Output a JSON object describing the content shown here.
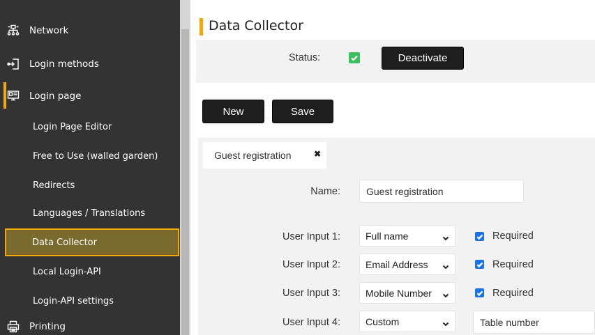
{
  "sidebar": {
    "items": [
      {
        "label": "Network",
        "icon": "network-icon"
      },
      {
        "label": "Login methods",
        "icon": "login-methods-icon"
      },
      {
        "label": "Login page",
        "icon": "login-page-icon"
      },
      {
        "label": "Printing",
        "icon": "printer-icon"
      }
    ],
    "subitems": [
      {
        "label": "Login Page Editor"
      },
      {
        "label": "Free to Use (walled garden)"
      },
      {
        "label": "Redirects"
      },
      {
        "label": "Languages / Translations"
      },
      {
        "label": "Data Collector",
        "active": true
      },
      {
        "label": "Local Login-API"
      },
      {
        "label": "Login-API settings"
      }
    ]
  },
  "page": {
    "title": "Data Collector"
  },
  "status": {
    "label": "Status:",
    "checked": true,
    "deactivate_label": "Deactivate"
  },
  "toolbar": {
    "new_label": "New",
    "save_label": "Save"
  },
  "tabs": [
    {
      "label": "Guest registration",
      "close": "✖"
    }
  ],
  "form": {
    "name_label": "Name:",
    "name_value": "Guest registration",
    "inputs": [
      {
        "label": "User Input 1:",
        "selected": "Full name",
        "required": true,
        "required_label": "Required"
      },
      {
        "label": "User Input 2:",
        "selected": "Email Address",
        "required": true,
        "required_label": "Required"
      },
      {
        "label": "User Input 3:",
        "selected": "Mobile Number",
        "required": true,
        "required_label": "Required"
      },
      {
        "label": "User Input 4:",
        "selected": "Custom",
        "custom_value": "Table number"
      }
    ]
  },
  "colors": {
    "sidebar_bg": "#333333",
    "accent": "#f5a800",
    "active_bg": "#7a6a2e",
    "button_bg": "#1e1e1e",
    "status_green": "#3cbf5c",
    "checkbox_blue": "#1a73e8"
  }
}
